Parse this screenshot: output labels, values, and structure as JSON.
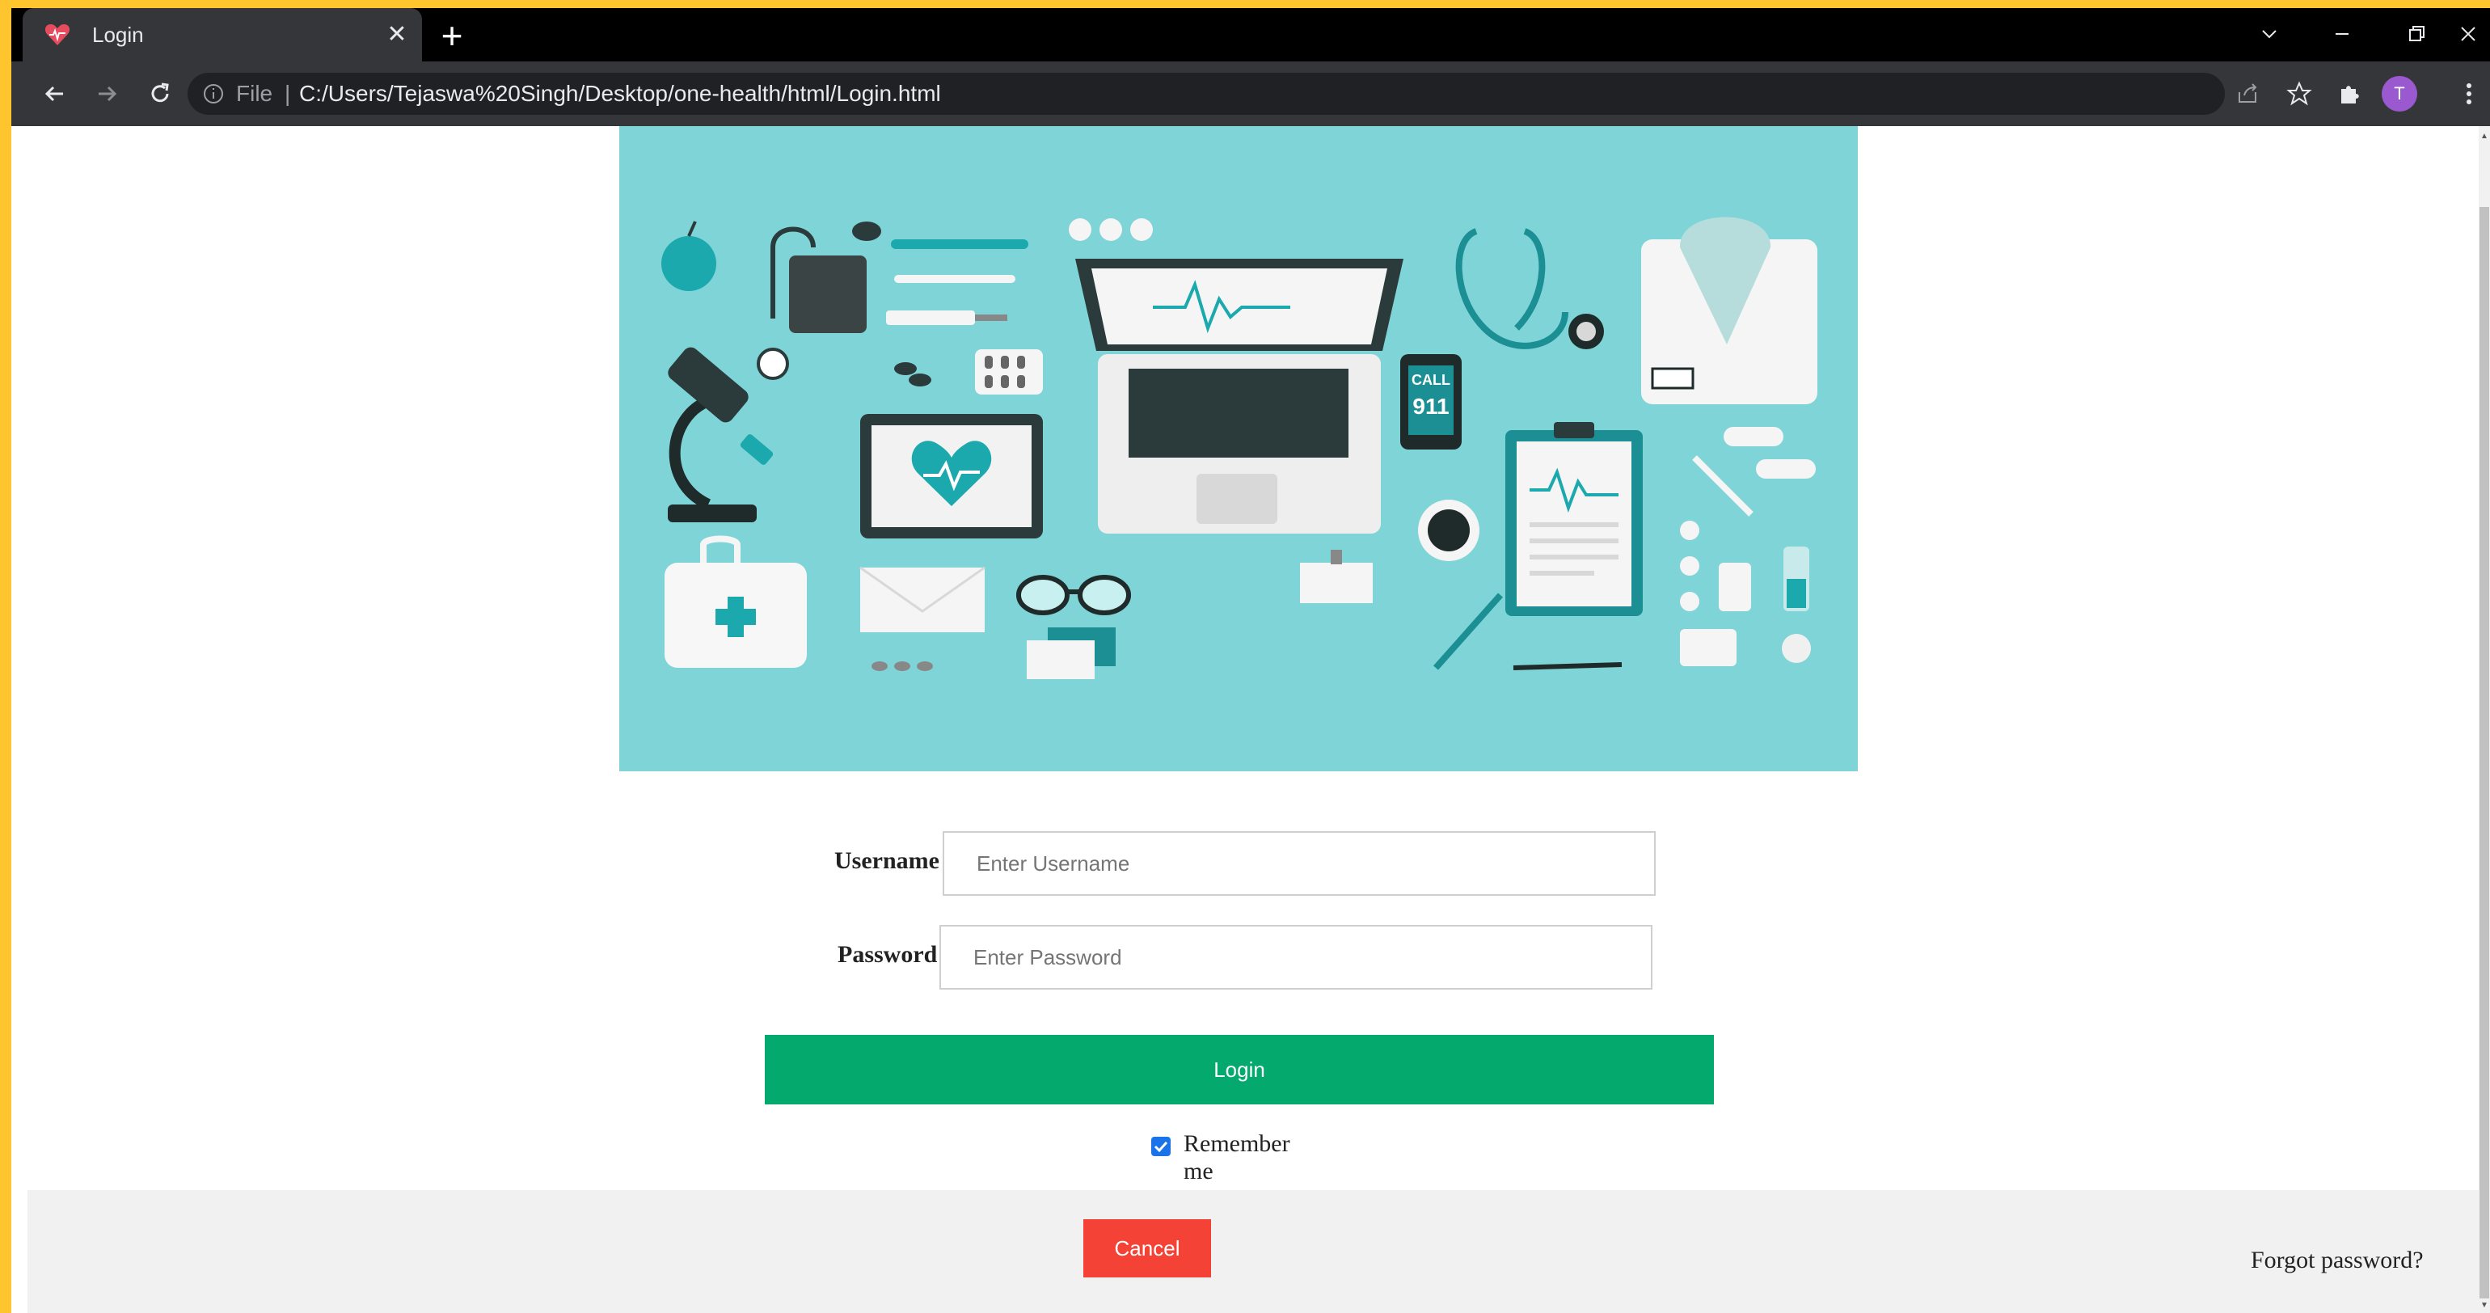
{
  "browser": {
    "tab_title": "Login",
    "address": {
      "scheme_label": "File",
      "url": "C:/Users/Tejaswa%20Singh/Desktop/one-health/html/Login.html"
    },
    "profile_initial": "T"
  },
  "hero": {
    "call_sign_line1": "CALL",
    "call_sign_line2": "911"
  },
  "form": {
    "username_label": "Username",
    "username_placeholder": "Enter Username",
    "password_label": "Password",
    "password_placeholder": "Enter Password",
    "login_button": "Login",
    "remember_label": "Remember me",
    "cancel_button": "Cancel",
    "forgot_password": "Forgot password?"
  },
  "colors": {
    "hero_bg": "#7fd4d8",
    "login_button": "#04a96d",
    "cancel_button": "#f44336",
    "accent": "#1ba9ad"
  }
}
